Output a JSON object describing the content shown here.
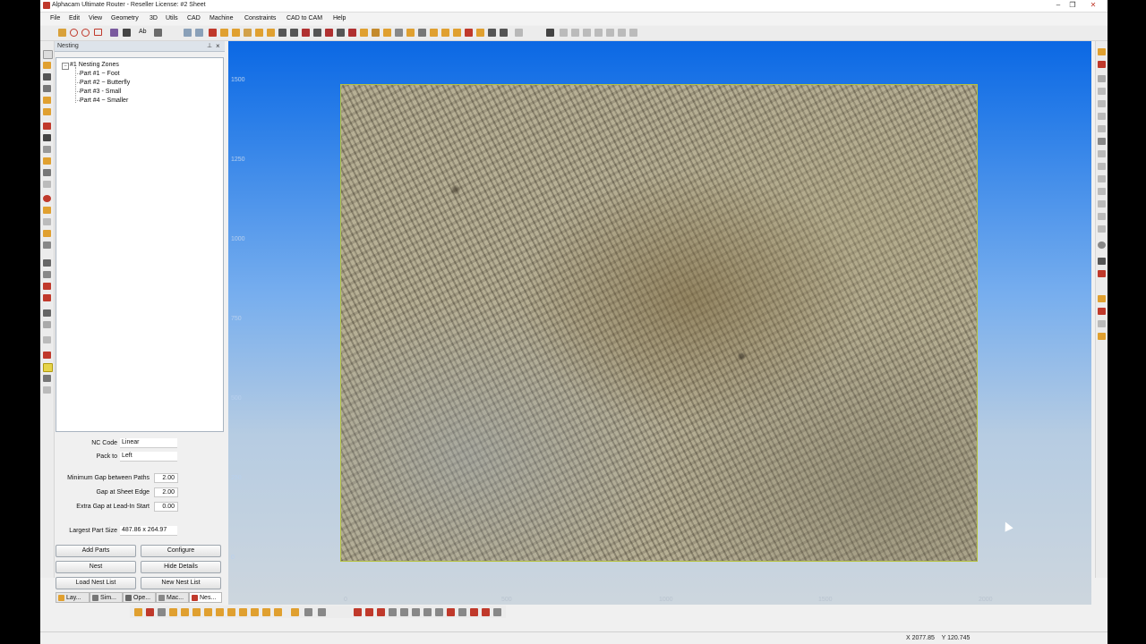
{
  "window": {
    "title": "Alphacam Ultimate Router - Reseller License: #2 Sheet"
  },
  "menu": [
    "File",
    "Edit",
    "View",
    "Geometry",
    "3D",
    "Utils",
    "CAD",
    "Machine",
    "Constraints",
    "CAD to CAM",
    "Help"
  ],
  "panel": {
    "title": "Nesting",
    "tree": {
      "root": "#1 Nesting Zones",
      "items": [
        "Part #1 ~ Foot",
        "Part #2 ~ Butterfly",
        "Part #3 - Small",
        "Part #4 ~ Smaller"
      ]
    },
    "props": {
      "nc_code_label": "NC Code",
      "nc_code_value": "Linear",
      "pack_to_label": "Pack to",
      "pack_to_value": "Left",
      "min_gap_label": "Minimum Gap between Paths",
      "min_gap_value": "2.00",
      "sheet_edge_label": "Gap at Sheet Edge",
      "sheet_edge_value": "2.00",
      "extra_gap_label": "Extra Gap at Lead-In Start",
      "extra_gap_value": "0.00",
      "largest_label": "Largest Part Size",
      "largest_value": "487.86 x 264.97"
    },
    "buttons": {
      "add_parts": "Add Parts",
      "configure": "Configure",
      "nest": "Nest",
      "hide_details": "Hide Details",
      "load_nest_list": "Load Nest List",
      "new_nest_list": "New Nest List"
    },
    "tabs": [
      "Lay...",
      "Sim...",
      "Ope...",
      "Mac...",
      "Nes..."
    ]
  },
  "viewport": {
    "y_ticks": [
      "1500",
      "1250",
      "1000",
      "750",
      "500",
      "250",
      "0"
    ],
    "x_ticks": [
      "0",
      "500",
      "1000",
      "1500",
      "2000"
    ]
  },
  "status": {
    "x": "X 2077.85",
    "y": "Y 120.745"
  },
  "colors": {
    "viewport_top": "#0b68e4",
    "viewport_bottom": "#cdd6de",
    "sheet_border": "#b6c23c"
  }
}
